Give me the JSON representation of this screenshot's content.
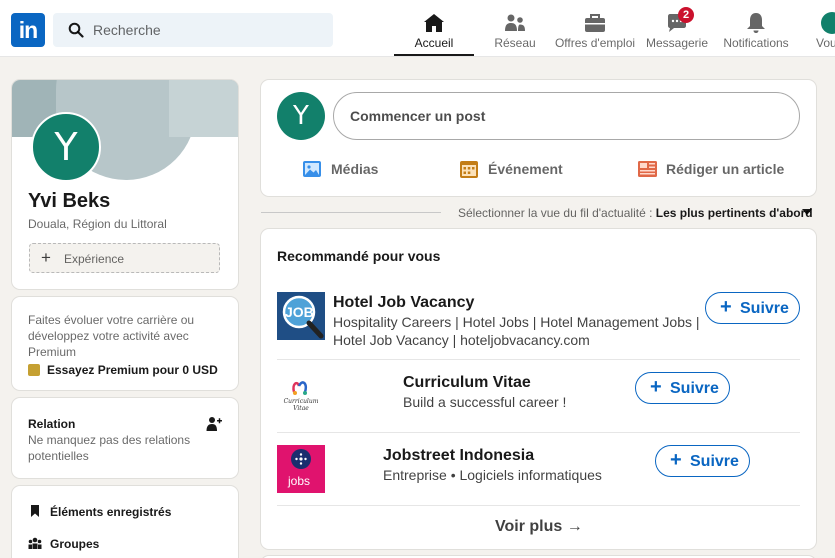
{
  "nav": {
    "logo_text": "in",
    "search_placeholder": "Recherche",
    "items": [
      {
        "label": "Accueil",
        "icon": "home-icon",
        "active": true
      },
      {
        "label": "Réseau",
        "icon": "network-icon"
      },
      {
        "label": "Offres d'emploi",
        "icon": "jobs-icon"
      },
      {
        "label": "Messagerie",
        "icon": "messaging-icon",
        "badge": "2"
      },
      {
        "label": "Notifications",
        "icon": "notifications-icon"
      },
      {
        "label": "Vous",
        "icon": "me-icon"
      }
    ]
  },
  "profile": {
    "initial": "Y",
    "name": "Yvi Beks",
    "location": "Douala, Région du Littoral",
    "experience_label": "Expérience"
  },
  "premium": {
    "text": "Faites évoluer votre carrière ou développez votre activité avec Premium",
    "cta": "Essayez Premium pour 0 USD"
  },
  "relations": {
    "title": "Relation",
    "subtitle": "Ne manquez pas des relations potentielles"
  },
  "side_links": [
    {
      "label": "Éléments enregistrés",
      "icon": "bookmark-icon"
    },
    {
      "label": "Groupes",
      "icon": "groups-icon"
    }
  ],
  "share": {
    "initial": "Y",
    "placeholder": "Commencer un post",
    "actions": [
      {
        "label": "Médias",
        "icon": "media-icon",
        "color": "#378fe9"
      },
      {
        "label": "Événement",
        "icon": "event-icon",
        "color": "#c37d16"
      },
      {
        "label": "Rédiger un article",
        "icon": "article-icon",
        "color": "#e06847"
      }
    ]
  },
  "feed_sort": {
    "prefix": "Sélectionner la vue du fil d'actualité : ",
    "value": "Les plus pertinents d'abord"
  },
  "recommendations": {
    "title": "Recommandé pour vous",
    "follow_label": "Suivre",
    "items": [
      {
        "name": "Hotel Job Vacancy",
        "description": "Hospitality Careers | Hotel Jobs | Hotel Management Jobs | Hotel Job Vacancy | hoteljobvacancy.com",
        "logo_text": "JOB"
      },
      {
        "name": "Curriculum Vitae",
        "description": "Build a successful career !",
        "logo_text": "Curriculum Vitae"
      },
      {
        "name": "Jobstreet Indonesia",
        "description": "Entreprise • Logiciels informatiques",
        "logo_text": "jobs"
      }
    ],
    "see_more": "Voir plus →"
  },
  "colors": {
    "brand": "#0a66c2",
    "background": "#f4f2ee",
    "avatar": "#12806b",
    "badge": "#cb112d"
  }
}
